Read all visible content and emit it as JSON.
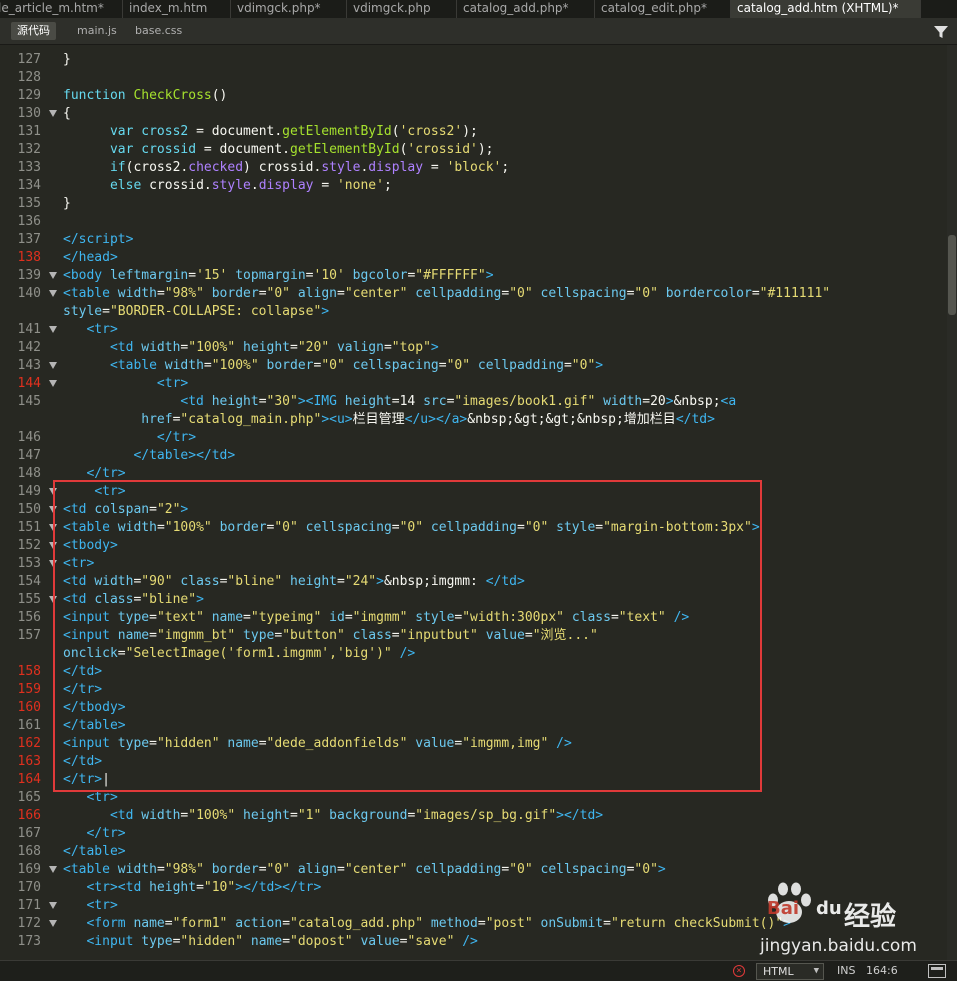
{
  "tabs": [
    {
      "label": "le_article_m.htm*"
    },
    {
      "label": "index_m.htm"
    },
    {
      "label": "vdimgck.php*"
    },
    {
      "label": "vdimgck.php"
    },
    {
      "label": "catalog_add.php*"
    },
    {
      "label": "catalog_edit.php*"
    },
    {
      "label": "catalog_add.htm (XHTML)*"
    }
  ],
  "related_files": [
    {
      "label": "源代码"
    },
    {
      "label": "main.js"
    },
    {
      "label": "base.css"
    }
  ],
  "lines": [
    {
      "n": "127",
      "html": "}"
    },
    {
      "n": "128",
      "html": ""
    },
    {
      "n": "129",
      "html": "<span class='t-kw'>function</span> <span class='t-fn'>CheckCross</span>()"
    },
    {
      "n": "130",
      "html": "{"
    },
    {
      "n": "131",
      "html": "      <span class='t-kw'>var</span> <span class='t-kw'>cross2</span> = document.<span class='t-fn'>getElementById</span>(<span class='t-str'>'cross2'</span>);"
    },
    {
      "n": "132",
      "html": "      <span class='t-kw'>var</span> <span class='t-kw'>crossid</span> = document.<span class='t-fn'>getElementById</span>(<span class='t-str'>'crossid'</span>);"
    },
    {
      "n": "133",
      "html": "      <span class='t-kw'>if</span>(cross2.<span class='t-prop'>checked</span>) crossid.<span class='t-prop'>style</span>.<span class='t-prop'>display</span> = <span class='t-str'>'block'</span>;"
    },
    {
      "n": "134",
      "html": "      <span class='t-kw'>else</span> crossid.<span class='t-prop'>style</span>.<span class='t-prop'>display</span> = <span class='t-str'>'none'</span>;"
    },
    {
      "n": "135",
      "html": "}"
    },
    {
      "n": "136",
      "html": ""
    },
    {
      "n": "137",
      "html": "<span class='t-tag'>&lt;/script&gt;</span>"
    },
    {
      "n": "138",
      "html": "<span class='t-tag'>&lt;/head&gt;</span>"
    },
    {
      "n": "139",
      "html": "<span class='t-tag'>&lt;body</span> <span class='t-attr'>leftmargin</span>=<span class='t-str'>'15'</span> <span class='t-attr'>topmargin</span>=<span class='t-str'>'10'</span> <span class='t-attr'>bgcolor</span>=<span class='t-str'>\"#FFFFFF\"</span><span class='t-tag'>&gt;</span>"
    },
    {
      "n": "140",
      "html": "<span class='t-tag'>&lt;table</span> <span class='t-attr'>width</span>=<span class='t-str'>\"98%\"</span> <span class='t-attr'>border</span>=<span class='t-str'>\"0\"</span> <span class='t-attr'>align</span>=<span class='t-str'>\"center\"</span> <span class='t-attr'>cellpadding</span>=<span class='t-str'>\"0\"</span> <span class='t-attr'>cellspacing</span>=<span class='t-str'>\"0\"</span> <span class='t-attr'>bordercolor</span>=<span class='t-str'>\"#111111\"</span>"
    },
    {
      "n": "",
      "html": "<span class='t-attr'>style</span>=<span class='t-str'>\"BORDER-COLLAPSE: collapse\"</span><span class='t-tag'>&gt;</span>"
    },
    {
      "n": "141",
      "html": "   <span class='t-tag'>&lt;tr&gt;</span>"
    },
    {
      "n": "142",
      "html": "      <span class='t-tag'>&lt;td</span> <span class='t-attr'>width</span>=<span class='t-str'>\"100%\"</span> <span class='t-attr'>height</span>=<span class='t-str'>\"20\"</span> <span class='t-attr'>valign</span>=<span class='t-str'>\"top\"</span><span class='t-tag'>&gt;</span>"
    },
    {
      "n": "143",
      "html": "      <span class='t-tag'>&lt;table</span> <span class='t-attr'>width</span>=<span class='t-str'>\"100%\"</span> <span class='t-attr'>border</span>=<span class='t-str'>\"0\"</span> <span class='t-attr'>cellspacing</span>=<span class='t-str'>\"0\"</span> <span class='t-attr'>cellpadding</span>=<span class='t-str'>\"0\"</span><span class='t-tag'>&gt;</span>"
    },
    {
      "n": "144",
      "html": "            <span class='t-tag'>&lt;tr&gt;</span>"
    },
    {
      "n": "145",
      "html": "               <span class='t-tag'>&lt;td</span> <span class='t-attr'>height</span>=<span class='t-str'>\"30\"</span><span class='t-tag'>&gt;&lt;IMG</span> <span class='t-attr'>height</span>=14 <span class='t-attr'>src</span>=<span class='t-str'>\"images/book1.gif\"</span> <span class='t-attr'>width</span>=20<span class='t-tag'>&gt;</span>&amp;nbsp;<span class='t-tag'>&lt;a</span>"
    },
    {
      "n": "",
      "html": "          <span class='t-attr'>href</span>=<span class='t-str'>\"catalog_main.php\"</span><span class='t-tag'>&gt;&lt;u&gt;</span>栏目管理<span class='t-tag'>&lt;/u&gt;&lt;/a&gt;</span>&amp;nbsp;&amp;gt;&amp;gt;&amp;nbsp;增加栏目<span class='t-tag'>&lt;/td&gt;</span>"
    },
    {
      "n": "146",
      "html": "            <span class='t-tag'>&lt;/tr&gt;</span>"
    },
    {
      "n": "147",
      "html": "         <span class='t-tag'>&lt;/table&gt;&lt;/td&gt;</span>"
    },
    {
      "n": "148",
      "html": "   <span class='t-tag'>&lt;/tr&gt;</span>"
    },
    {
      "n": "149",
      "html": "    <span class='t-tag'>&lt;tr&gt;</span>"
    },
    {
      "n": "150",
      "html": "<span class='t-tag'>&lt;td</span> <span class='t-attr'>colspan</span>=<span class='t-str'>\"2\"</span><span class='t-tag'>&gt;</span>"
    },
    {
      "n": "151",
      "html": "<span class='t-tag'>&lt;table</span> <span class='t-attr'>width</span>=<span class='t-str'>\"100%\"</span> <span class='t-attr'>border</span>=<span class='t-str'>\"0\"</span> <span class='t-attr'>cellspacing</span>=<span class='t-str'>\"0\"</span> <span class='t-attr'>cellpadding</span>=<span class='t-str'>\"0\"</span> <span class='t-attr'>style</span>=<span class='t-str'>\"margin-bottom:3px\"</span><span class='t-tag'>&gt;</span>"
    },
    {
      "n": "152",
      "html": "<span class='t-tag'>&lt;tbody&gt;</span>"
    },
    {
      "n": "153",
      "html": "<span class='t-tag'>&lt;tr&gt;</span>"
    },
    {
      "n": "154",
      "html": "<span class='t-tag'>&lt;td</span> <span class='t-attr'>width</span>=<span class='t-str'>\"90\"</span> <span class='t-attr'>class</span>=<span class='t-str'>\"bline\"</span> <span class='t-attr'>height</span>=<span class='t-str'>\"24\"</span><span class='t-tag'>&gt;</span>&amp;nbsp;imgmm: <span class='t-tag'>&lt;/td&gt;</span>"
    },
    {
      "n": "155",
      "html": "<span class='t-tag'>&lt;td</span> <span class='t-attr'>class</span>=<span class='t-str'>\"bline\"</span><span class='t-tag'>&gt;</span>"
    },
    {
      "n": "156",
      "html": "<span class='t-tag'>&lt;input</span> <span class='t-attr'>type</span>=<span class='t-str'>\"text\"</span> <span class='t-attr'>name</span>=<span class='t-str'>\"typeimg\"</span> <span class='t-attr'>id</span>=<span class='t-str'>\"imgmm\"</span> <span class='t-attr'>style</span>=<span class='t-str'>\"width:300px\"</span> <span class='t-attr'>class</span>=<span class='t-str'>\"text\"</span> <span class='t-tag'>/&gt;</span>"
    },
    {
      "n": "157",
      "html": "<span class='t-tag'>&lt;input</span> <span class='t-attr'>name</span>=<span class='t-str'>\"imgmm_bt\"</span> <span class='t-attr'>type</span>=<span class='t-str'>\"button\"</span> <span class='t-attr'>class</span>=<span class='t-str'>\"inputbut\"</span> <span class='t-attr'>value</span>=<span class='t-str'>\"浏览...\"</span>"
    },
    {
      "n": "",
      "html": "<span class='t-attr'>onclick</span>=<span class='t-str'>\"SelectImage('form1.imgmm','big')\"</span> <span class='t-tag'>/&gt;</span>"
    },
    {
      "n": "158",
      "html": "<span class='t-tag'>&lt;/td&gt;</span>"
    },
    {
      "n": "159",
      "html": "<span class='t-tag'>&lt;/tr&gt;</span>"
    },
    {
      "n": "160",
      "html": "<span class='t-tag'>&lt;/tbody&gt;</span>"
    },
    {
      "n": "161",
      "html": "<span class='t-tag'>&lt;/table&gt;</span>"
    },
    {
      "n": "162",
      "html": "<span class='t-tag'>&lt;input</span> <span class='t-attr'>type</span>=<span class='t-str'>\"hidden\"</span> <span class='t-attr'>name</span>=<span class='t-str'>\"dede_addonfields\"</span> <span class='t-attr'>value</span>=<span class='t-str'>\"imgmm,img\"</span> <span class='t-tag'>/&gt;</span>"
    },
    {
      "n": "163",
      "html": "<span class='t-tag'>&lt;/td&gt;</span>"
    },
    {
      "n": "164",
      "html": "<span class='t-tag'>&lt;/tr&gt;</span>|"
    },
    {
      "n": "165",
      "html": "   <span class='t-tag'>&lt;tr&gt;</span>"
    },
    {
      "n": "166",
      "html": "      <span class='t-tag'>&lt;td</span> <span class='t-attr'>width</span>=<span class='t-str'>\"100%\"</span> <span class='t-attr'>height</span>=<span class='t-str'>\"1\"</span> <span class='t-attr'>background</span>=<span class='t-str'>\"images/sp_bg.gif\"</span><span class='t-tag'>&gt;&lt;/td&gt;</span>"
    },
    {
      "n": "167",
      "html": "   <span class='t-tag'>&lt;/tr&gt;</span>"
    },
    {
      "n": "168",
      "html": "<span class='t-tag'>&lt;/table&gt;</span>"
    },
    {
      "n": "169",
      "html": "<span class='t-tag'>&lt;table</span> <span class='t-attr'>width</span>=<span class='t-str'>\"98%\"</span> <span class='t-attr'>border</span>=<span class='t-str'>\"0\"</span> <span class='t-attr'>align</span>=<span class='t-str'>\"center\"</span> <span class='t-attr'>cellpadding</span>=<span class='t-str'>\"0\"</span> <span class='t-attr'>cellspacing</span>=<span class='t-str'>\"0\"</span><span class='t-tag'>&gt;</span>"
    },
    {
      "n": "170",
      "html": "   <span class='t-tag'>&lt;tr&gt;&lt;td</span> <span class='t-attr'>height</span>=<span class='t-str'>\"10\"</span><span class='t-tag'>&gt;&lt;/td&gt;&lt;/tr&gt;</span>"
    },
    {
      "n": "171",
      "html": "   <span class='t-tag'>&lt;tr&gt;</span>"
    },
    {
      "n": "172",
      "html": "   <span class='t-tag'>&lt;form</span> <span class='t-attr'>name</span>=<span class='t-str'>\"form1\"</span> <span class='t-attr'>action</span>=<span class='t-str'>\"catalog_add.php\"</span> <span class='t-attr'>method</span>=<span class='t-str'>\"post\"</span> <span class='t-attr'>onSubmit</span>=<span class='t-str'>\"return checkSubmit()\"</span><span class='t-tag'>&gt;</span>"
    },
    {
      "n": "173",
      "html": "   <span class='t-tag'>&lt;input</span> <span class='t-attr'>type</span>=<span class='t-str'>\"hidden\"</span> <span class='t-attr'>name</span>=<span class='t-str'>\"dopost\"</span> <span class='t-attr'>value</span>=<span class='t-str'>\"save\"</span> <span class='t-tag'>/&gt;</span>"
    }
  ],
  "status": {
    "language": "HTML",
    "mode": "INS",
    "cursor": "164:6"
  },
  "watermark": {
    "brand_cn": "经验",
    "url": "jingyan.baidu.com",
    "bai": "Bai",
    "du": "du"
  }
}
